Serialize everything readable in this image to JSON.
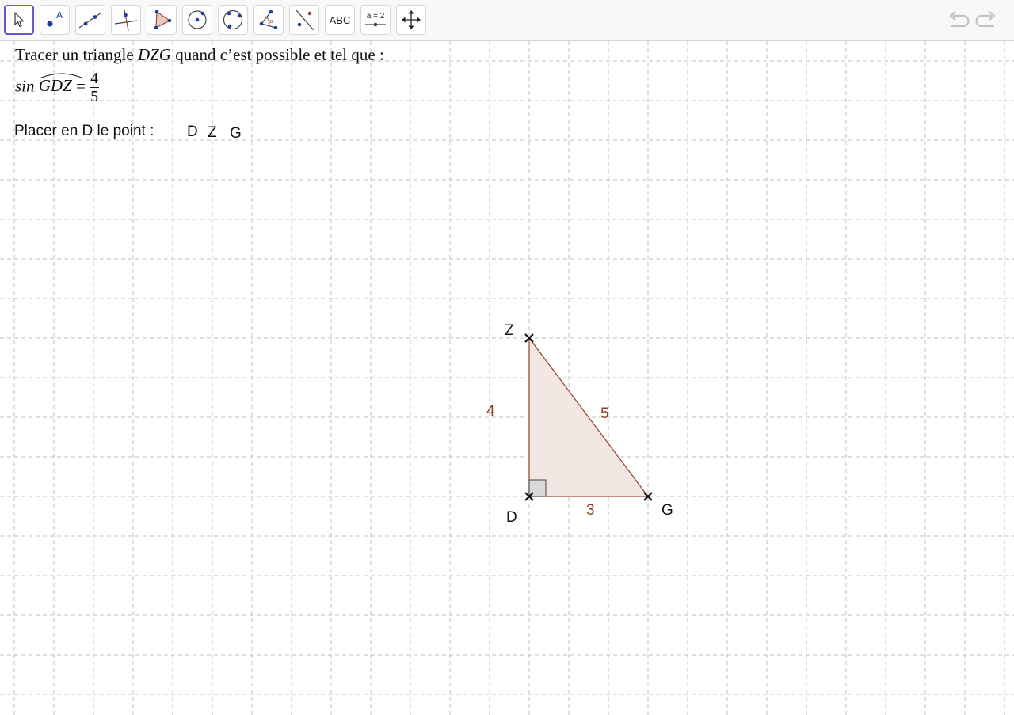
{
  "toolbar": {
    "tools": [
      {
        "id": "move",
        "icon": "cursor-arrow-icon",
        "active": true
      },
      {
        "id": "point",
        "icon": "point-icon",
        "label": "A"
      },
      {
        "id": "line",
        "icon": "line-through-points-icon"
      },
      {
        "id": "perpendicular",
        "icon": "perpendicular-line-icon"
      },
      {
        "id": "polygon",
        "icon": "polygon-icon"
      },
      {
        "id": "circle",
        "icon": "circle-center-point-icon"
      },
      {
        "id": "circle-three-points",
        "icon": "circle-three-points-icon"
      },
      {
        "id": "angle",
        "icon": "angle-icon",
        "label": "α"
      },
      {
        "id": "reflect",
        "icon": "reflect-about-line-icon"
      },
      {
        "id": "text",
        "icon": "text-tool-icon",
        "label": "ABC"
      },
      {
        "id": "slider",
        "icon": "slider-icon",
        "label": "a = 2"
      },
      {
        "id": "move-view",
        "icon": "move-graphics-view-icon"
      }
    ],
    "undo_icon": "undo-icon",
    "redo_icon": "redo-icon"
  },
  "statement": {
    "line1_pre": "Tracer un triangle ",
    "line1_math": "DZG",
    "line1_post": " quand c’est possible et tel que :",
    "sin_label": "sin",
    "angle_name": "GDZ",
    "equals": "=",
    "fraction_numerator": "4",
    "fraction_denominator": "5"
  },
  "place_prompt": "Placer en D le point :",
  "point_choices": [
    "D",
    "Z",
    "G"
  ],
  "triangle": {
    "vertices": {
      "D": {
        "label": "D"
      },
      "Z": {
        "label": "Z"
      },
      "G": {
        "label": "G"
      }
    },
    "side_DZ": "4",
    "side_ZG": "5",
    "side_DG": "3",
    "right_angle_at": "D",
    "fill_color": "#f3e7e4",
    "stroke_color": "#9b4a35",
    "label_color": "#8b3f28"
  },
  "grid": {
    "line_color": "#c0c0c0",
    "dashed": true
  }
}
